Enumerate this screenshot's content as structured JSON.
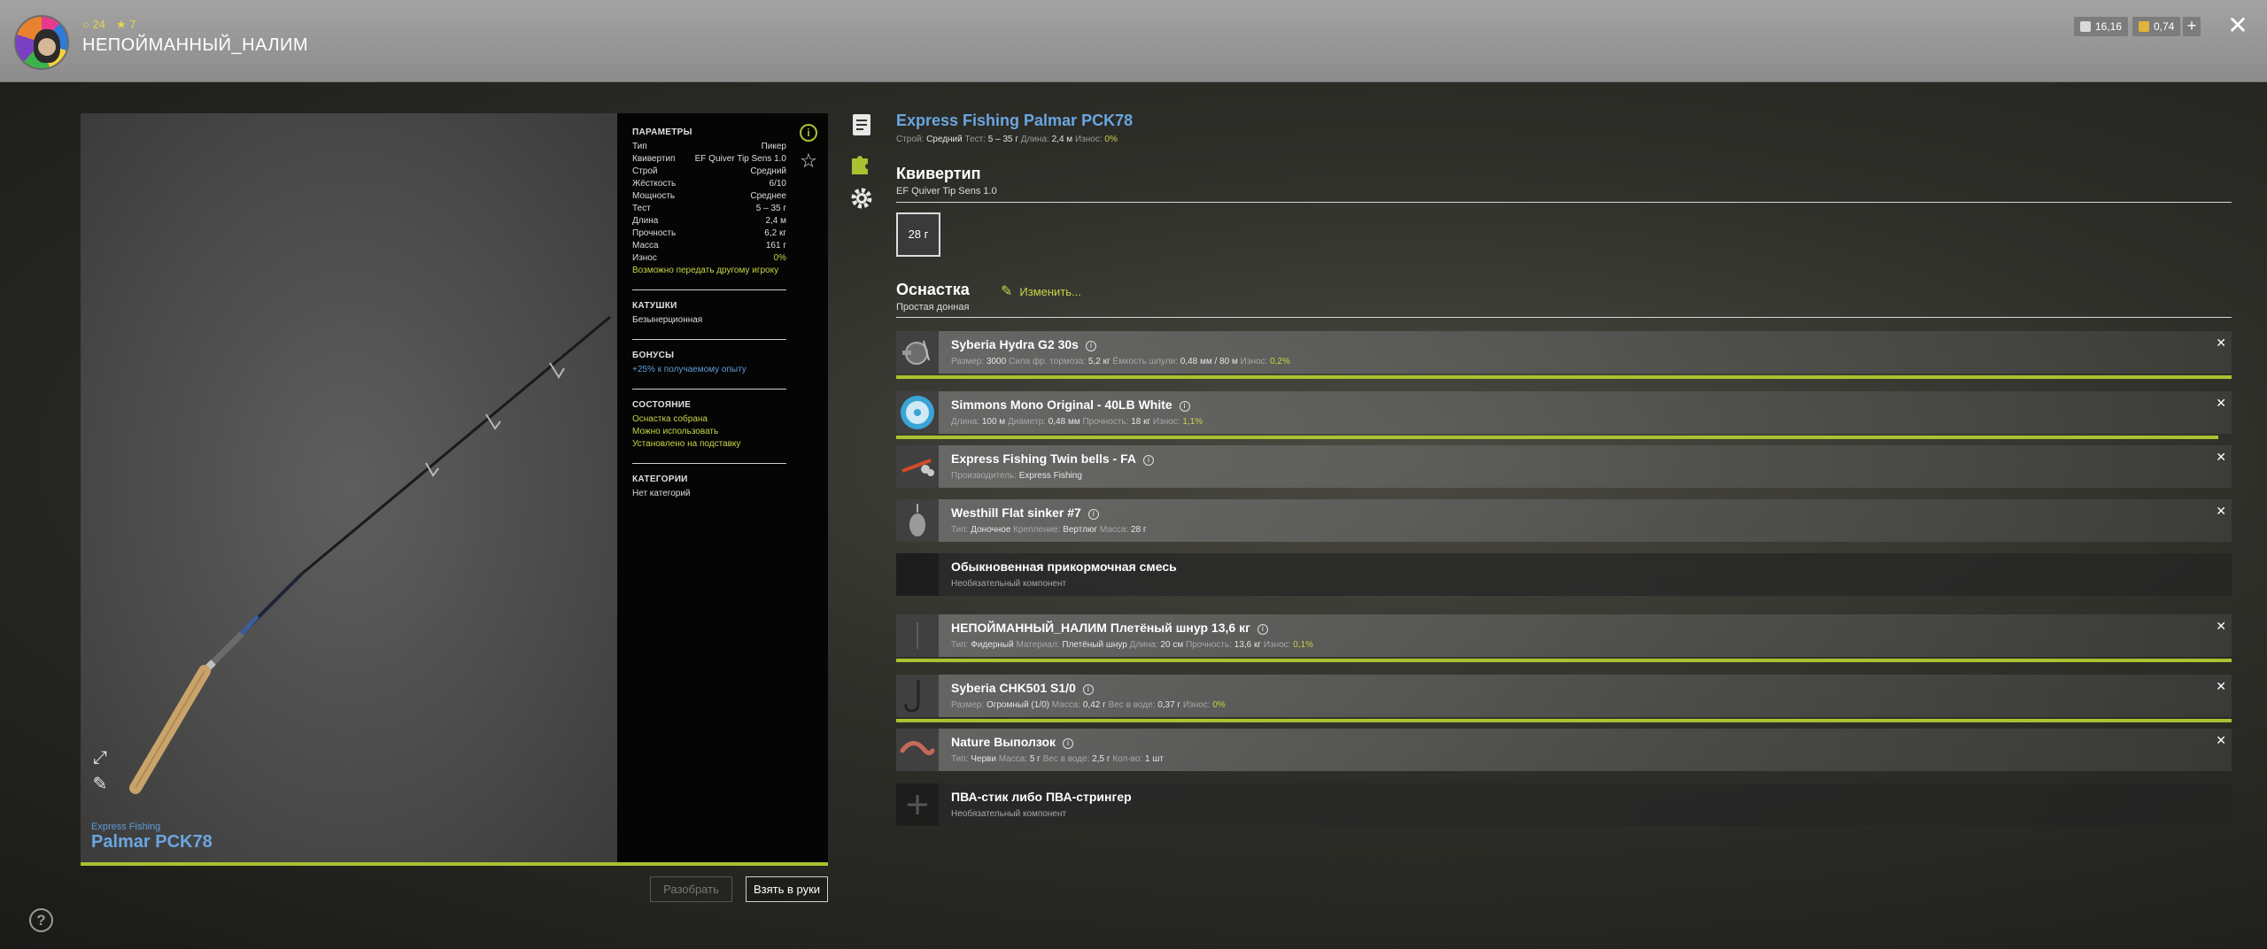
{
  "header": {
    "player_name": "НЕПОЙМАННЫЙ_НАЛИМ",
    "stat_level": "24",
    "stat_stars": "7",
    "currency_1": "16,16",
    "currency_2": "0,74",
    "plus": "+",
    "close": "✕"
  },
  "preview": {
    "brand": "Express Fishing",
    "model": "Palmar PCK78"
  },
  "params": {
    "section_params": "ПАРАМЕТРЫ",
    "rows": [
      {
        "k": "Тип",
        "v": "Пикер"
      },
      {
        "k": "Квивертип",
        "v": "EF Quiver Tip Sens 1.0"
      },
      {
        "k": "Строй",
        "v": "Средний"
      },
      {
        "k": "Жёсткость",
        "v": "6/10"
      },
      {
        "k": "Мощность",
        "v": "Среднее"
      },
      {
        "k": "Тест",
        "v": "5 – 35 г"
      },
      {
        "k": "Длина",
        "v": "2,4 м"
      },
      {
        "k": "Прочность",
        "v": "6,2 кг"
      },
      {
        "k": "Масса",
        "v": "161 г"
      },
      {
        "k": "Износ",
        "v": "0%"
      }
    ],
    "transfer_note": "Возможно передать другому игроку",
    "section_reels": "КАТУШКИ",
    "reels_value": "Безынерционная",
    "section_bonuses": "БОНУСЫ",
    "bonus_value": "+25% к получаемому опыту",
    "section_state": "СОСТОЯНИЕ",
    "state_1": "Оснастка собрана",
    "state_2": "Можно использовать",
    "state_3": "Установлено на подставку",
    "section_categories": "КАТЕГОРИИ",
    "categories_value": "Нет категорий"
  },
  "buttons": {
    "disassemble": "Разобрать",
    "take": "Взять в руки"
  },
  "rod": {
    "title": "Express Fishing Palmar PCK78",
    "sub": [
      {
        "k": "Строй:",
        "v": "Средний"
      },
      {
        "k": "Тест:",
        "v": "5 – 35 г"
      },
      {
        "k": "Длина:",
        "v": "2,4 м"
      },
      {
        "k": "Износ:",
        "v": "0%"
      }
    ]
  },
  "quiver": {
    "title": "Квивертип",
    "sub": "EF Quiver Tip Sens 1.0",
    "box": "28 г"
  },
  "rig": {
    "title": "Оснастка",
    "sub": "Простая донная",
    "edit": "Изменить..."
  },
  "slots": [
    {
      "name": "Syberia Hydra G2 30s",
      "meta": [
        {
          "k": "Размер:",
          "v": "3000"
        },
        {
          "k": "Сила фр. тормоза:",
          "v": "5,2 кг"
        },
        {
          "k": "Ёмкость шпули:",
          "v": "0,48 мм / 80 м"
        },
        {
          "k": "Износ:",
          "v": "0,2%",
          "hl": true
        }
      ],
      "bar": 1.0
    },
    {
      "name": "Simmons Mono Original - 40LB White",
      "meta": [
        {
          "k": "Длина:",
          "v": "100 м"
        },
        {
          "k": "Диаметр:",
          "v": "0,48 мм"
        },
        {
          "k": "Прочность:",
          "v": "18 кг"
        },
        {
          "k": "Износ:",
          "v": "1,1%",
          "hl": true
        }
      ],
      "bar": 0.99
    },
    {
      "name": "Express Fishing Twin bells - FA",
      "meta": [
        {
          "k": "Производитель:",
          "v": "Express Fishing"
        }
      ],
      "bar": 0
    },
    {
      "name": "Westhill Flat sinker #7",
      "meta": [
        {
          "k": "Тип:",
          "v": "Доночное"
        },
        {
          "k": "Крепление:",
          "v": "Вертлюг"
        },
        {
          "k": "Масса:",
          "v": "28 г"
        }
      ],
      "bar": 0
    },
    {
      "name": "Обыкновенная прикормочная смесь",
      "meta": [
        {
          "k": "",
          "v": "Необязательный компонент",
          "muted": true
        }
      ],
      "bar": 0,
      "empty": true
    },
    {
      "name": "НЕПОЙМАННЫЙ_НАЛИМ Плетёный шнур 13,6 кг",
      "meta": [
        {
          "k": "Тип:",
          "v": "Фидерный"
        },
        {
          "k": "Материал:",
          "v": "Плетёный шнур"
        },
        {
          "k": "Длина:",
          "v": "20 см"
        },
        {
          "k": "Прочность:",
          "v": "13,6 кг"
        },
        {
          "k": "Износ:",
          "v": "0,1%",
          "hl": true
        }
      ],
      "bar": 1.0
    },
    {
      "name": "Syberia CHK501 S1/0",
      "meta": [
        {
          "k": "Размер:",
          "v": "Огромный (1/0)"
        },
        {
          "k": "Масса:",
          "v": "0,42 г"
        },
        {
          "k": "Вес в воде:",
          "v": "0,37 г"
        },
        {
          "k": "Износ:",
          "v": "0%",
          "hl": true
        }
      ],
      "bar": 1.0
    },
    {
      "name": "Nature Выползок",
      "meta": [
        {
          "k": "Тип:",
          "v": "Черви"
        },
        {
          "k": "Масса:",
          "v": "5 г"
        },
        {
          "k": "Вес в воде:",
          "v": "2,5 г"
        },
        {
          "k": "Кол-во:",
          "v": "1 шт"
        }
      ],
      "bar": 0
    },
    {
      "name": "ПВА-стик либо ПВА-стрингер",
      "meta": [
        {
          "k": "",
          "v": "Необязательный компонент",
          "muted": true
        }
      ],
      "bar": 0,
      "empty": true
    }
  ],
  "colors": {
    "accent": "#a9c230",
    "title_blue": "#6aa6e0",
    "highlight_yellow": "#c8d447"
  },
  "icons": [
    "info-icon",
    "star-icon",
    "expand-icon",
    "paint-brush-icon",
    "help-icon",
    "document-icon",
    "puzzle-icon",
    "gear-icon",
    "edit-icon",
    "close-icon",
    "plus-icon"
  ]
}
